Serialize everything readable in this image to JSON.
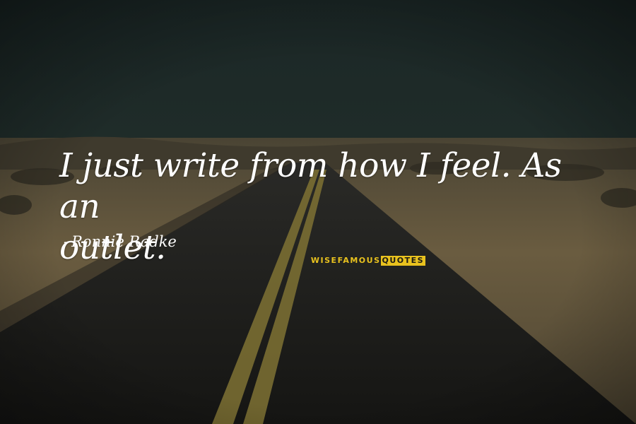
{
  "quote": {
    "line1": "I just write from how I feel. As an",
    "line2": "outlet."
  },
  "author": {
    "dash": "-",
    "name": "Ronnie Radke"
  },
  "watermark": {
    "part1": "WISEFAMOUS",
    "part2": "QUOTES"
  },
  "colors": {
    "sky": "#1e2a2a",
    "sand": "#5f5237",
    "road": "#1f1f1c",
    "road_line": "#8a7a36",
    "brand_yellow": "#e9c21e",
    "text": "#ffffff"
  },
  "scene": {
    "description_icon": "desert-road-background"
  }
}
